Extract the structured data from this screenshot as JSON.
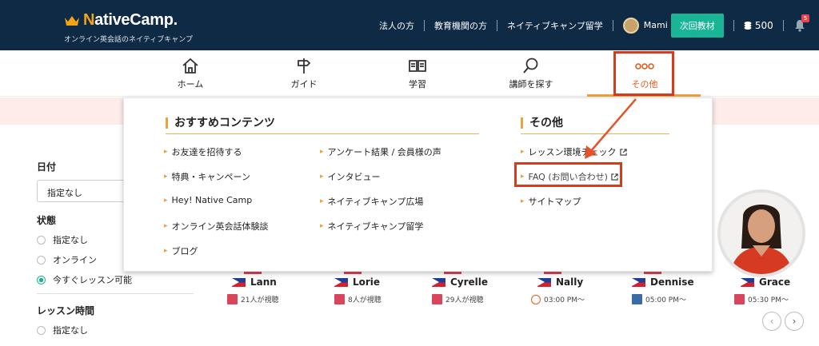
{
  "header": {
    "logo_text": "NativeCamp.",
    "tagline": "オンライン英会話のネイティブキャンプ",
    "links": [
      "法人の方",
      "教育機関の方",
      "ネイティブキャンプ留学"
    ],
    "user_name": "Mami",
    "next_material": "次回教材",
    "coins": "500",
    "notification_count": "5"
  },
  "main_nav": [
    {
      "label": "ホーム",
      "icon": "home-icon"
    },
    {
      "label": "ガイド",
      "icon": "signpost-icon"
    },
    {
      "label": "学習",
      "icon": "book-icon"
    },
    {
      "label": "講師を探す",
      "icon": "search-icon"
    },
    {
      "label": "その他",
      "icon": "more-dots-icon"
    }
  ],
  "dropdown": {
    "recommended_heading": "おすすめコンテンツ",
    "recommended_col1": [
      "お友達を招待する",
      "特典・キャンペーン",
      "Hey! Native Camp",
      "オンライン英会話体験談",
      "ブログ"
    ],
    "recommended_col2": [
      "アンケート結果 / 会員様の声",
      "インタビュー",
      "ネイティブキャンプ広場",
      "ネイティブキャンプ留学"
    ],
    "other_heading": "その他",
    "other_items": [
      "レッスン環境チェック",
      "FAQ (お問い合わせ)",
      "サイトマップ"
    ]
  },
  "sidebar": {
    "date_label": "日付",
    "date_value": "指定なし",
    "status_label": "状態",
    "status_options": [
      "指定なし",
      "オンライン",
      "今すぐレッスン可能"
    ],
    "lesson_time_label": "レッスン時間",
    "lesson_time_options": [
      "指定なし"
    ]
  },
  "teachers": [
    {
      "name": "Lann",
      "info": "21人が視聴"
    },
    {
      "name": "Lorie",
      "info": "8人が視聴"
    },
    {
      "name": "Cyrelle",
      "info": "29人が視聴"
    },
    {
      "name": "Nally",
      "info": "03:00 PM〜"
    },
    {
      "name": "Dennise",
      "info": "05:00 PM〜"
    },
    {
      "name": "Grace",
      "info": "05:30 PM〜"
    }
  ],
  "colors": {
    "header_bg": "#0f2a45",
    "accent_orange": "#f0a03a",
    "highlight_red": "#d83a1c",
    "button_green": "#18b597"
  }
}
